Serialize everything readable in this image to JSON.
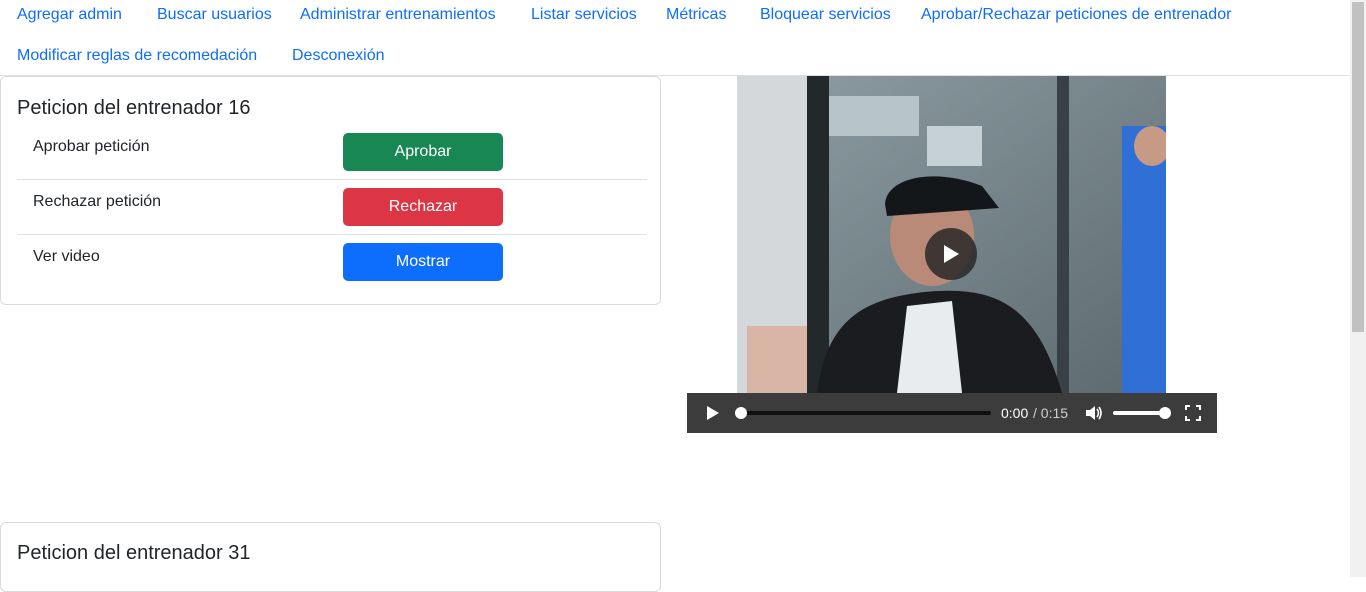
{
  "nav": {
    "items": [
      "Agregar admin",
      "Buscar usuarios",
      "Administrar entrenamientos",
      "Listar servicios",
      "Métricas",
      "Bloquear servicios",
      "Aprobar/Rechazar peticiones de entrenador",
      "Modificar reglas de recomedación",
      "Desconexión"
    ]
  },
  "requests": [
    {
      "title": "Peticion del entrenador 16",
      "approve_label": "Aprobar petición",
      "approve_button": "Aprobar",
      "reject_label": "Rechazar petición",
      "reject_button": "Rechazar",
      "video_label": "Ver video",
      "video_button": "Mostrar"
    },
    {
      "title": "Peticion del entrenador 31"
    }
  ],
  "video": {
    "current_time": "0:00",
    "duration": "/ 0:15",
    "progress": 0.0,
    "volume": 1.0
  },
  "colors": {
    "approve": "#198754",
    "reject": "#dc3545",
    "show": "#0d6efd",
    "link": "#0d6efd"
  }
}
